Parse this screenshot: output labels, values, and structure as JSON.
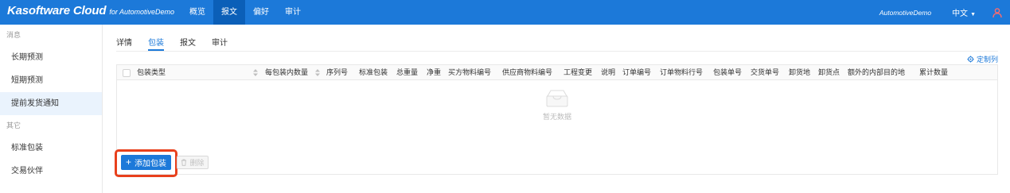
{
  "app": {
    "brand": "Kasoftware Cloud",
    "brand_sub": "for AutomotiveDemo"
  },
  "nav": {
    "items": [
      "概览",
      "报文",
      "偏好",
      "审计"
    ],
    "active_index": 1
  },
  "user": {
    "name": "AutomotiveDemo",
    "language": "中文"
  },
  "sidebar": {
    "group1": "消息",
    "items1": [
      "长期预测",
      "短期预测",
      "提前发货通知"
    ],
    "group2": "其它",
    "items2": [
      "标准包装",
      "交易伙伴"
    ],
    "active": "提前发货通知"
  },
  "tabs": {
    "items": [
      "详情",
      "包装",
      "报文",
      "审计"
    ],
    "active_index": 1
  },
  "table": {
    "custom_columns_label": "定制列",
    "columns": [
      "包装类型",
      "每包装内数量",
      "序列号",
      "标准包装",
      "总重量",
      "净重",
      "买方物料编号",
      "供应商物料编号",
      "工程变更",
      "说明",
      "订单编号",
      "订单物料行号",
      "包装单号",
      "交货单号",
      "卸货地",
      "卸货点",
      "额外的内部目的地",
      "累计数量"
    ],
    "empty_text": "暂无数据"
  },
  "actions": {
    "add_label": "添加包装",
    "delete_label": "删除"
  },
  "colors": {
    "primary": "#1c79d9",
    "highlight": "#e8401c",
    "user_icon": "#ff6b6b"
  },
  "icons": [
    "user-icon",
    "chevron-down-icon",
    "gear-icon",
    "sort-icon",
    "empty-box-icon",
    "plus-icon",
    "trash-icon"
  ]
}
